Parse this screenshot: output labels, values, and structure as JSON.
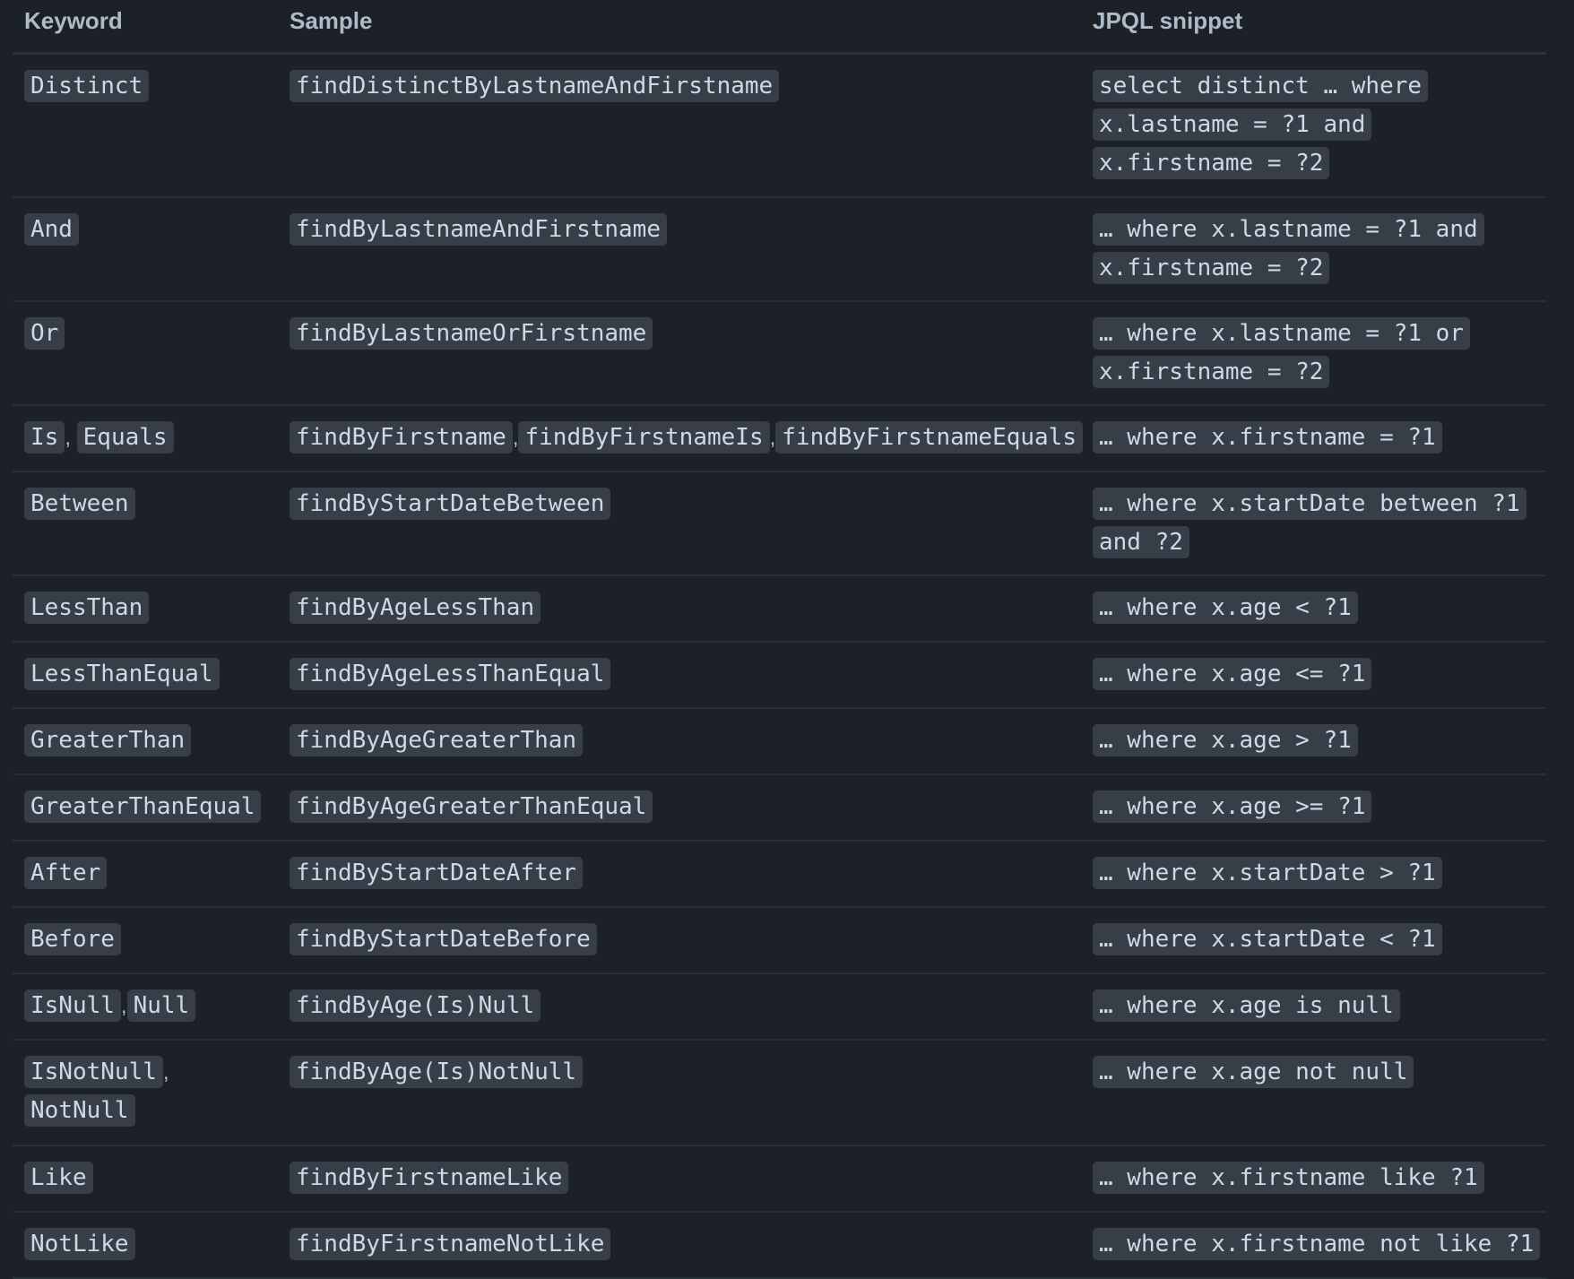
{
  "headers": {
    "keyword": "Keyword",
    "sample": "Sample",
    "jpql": "JPQL snippet"
  },
  "rows": [
    {
      "keywords": [
        "Distinct"
      ],
      "samples": [
        "findDistinctByLastnameAndFirstname"
      ],
      "jpql": "select distinct … where x.lastname = ?1 and x.firstname = ?2"
    },
    {
      "keywords": [
        "And"
      ],
      "samples": [
        "findByLastnameAndFirstname"
      ],
      "jpql": "… where x.lastname = ?1 and x.firstname = ?2"
    },
    {
      "keywords": [
        "Or"
      ],
      "samples": [
        "findByLastnameOrFirstname"
      ],
      "jpql": "… where x.lastname = ?1 or x.firstname = ?2"
    },
    {
      "keywords": [
        "Is",
        "Equals"
      ],
      "samples": [
        "findByFirstname",
        "findByFirstnameIs",
        "findByFirstnameEquals"
      ],
      "jpql": "… where x.firstname = ?1"
    },
    {
      "keywords": [
        "Between"
      ],
      "samples": [
        "findByStartDateBetween"
      ],
      "jpql": "… where x.startDate between ?1 and ?2"
    },
    {
      "keywords": [
        "LessThan"
      ],
      "samples": [
        "findByAgeLessThan"
      ],
      "jpql": "… where x.age < ?1"
    },
    {
      "keywords": [
        "LessThanEqual"
      ],
      "samples": [
        "findByAgeLessThanEqual"
      ],
      "jpql": "… where x.age <= ?1"
    },
    {
      "keywords": [
        "GreaterThan"
      ],
      "samples": [
        "findByAgeGreaterThan"
      ],
      "jpql": "… where x.age > ?1"
    },
    {
      "keywords": [
        "GreaterThanEqual"
      ],
      "samples": [
        "findByAgeGreaterThanEqual"
      ],
      "jpql": "… where x.age >= ?1"
    },
    {
      "keywords": [
        "After"
      ],
      "samples": [
        "findByStartDateAfter"
      ],
      "jpql": "… where x.startDate > ?1"
    },
    {
      "keywords": [
        "Before"
      ],
      "samples": [
        "findByStartDateBefore"
      ],
      "jpql": "… where x.startDate < ?1"
    },
    {
      "keywords": [
        "IsNull",
        "Null"
      ],
      "samples": [
        "findByAge(Is)Null"
      ],
      "jpql": "… where x.age is null"
    },
    {
      "keywords": [
        "IsNotNull",
        "NotNull"
      ],
      "samples": [
        "findByAge(Is)NotNull"
      ],
      "jpql": "… where x.age not null"
    },
    {
      "keywords": [
        "Like"
      ],
      "samples": [
        "findByFirstnameLike"
      ],
      "jpql": "… where x.firstname like ?1"
    },
    {
      "keywords": [
        "NotLike"
      ],
      "samples": [
        "findByFirstnameNotLike"
      ],
      "jpql": "… where x.firstname not like ?1"
    }
  ]
}
